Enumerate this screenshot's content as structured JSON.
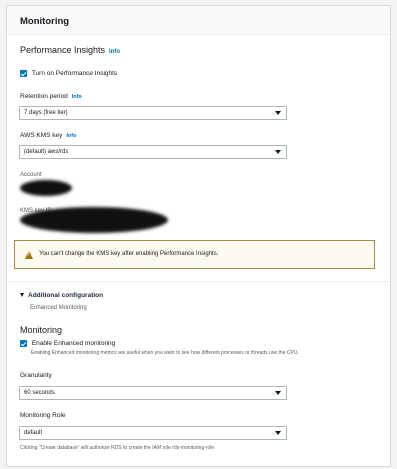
{
  "panel": {
    "title": "Monitoring"
  },
  "performance_insights": {
    "title": "Performance Insights",
    "info": "Info",
    "checkbox_label": "Turn on Performance Insights",
    "checked": true,
    "retention_label": "Retention period",
    "retention_info": "Info",
    "retention_value": "7 days (free tier)",
    "kms_label": "AWS KMS key",
    "kms_info": "Info",
    "kms_value": "(default) aws/rds",
    "account_label": "Account",
    "kms_key_id_label": "KMS key ID",
    "alert_text": "You can't change the KMS key after enabling Performance Insights."
  },
  "additional_configuration": {
    "title": "Additional configuration",
    "subtitle": "Enhanced Monitoring"
  },
  "monitoring": {
    "title": "Monitoring",
    "checkbox_label": "Enable Enhanced monitoring",
    "checked": true,
    "checkbox_description": "Enabling Enhanced monitoring metrics are useful when you want to see how different processes or threads use the CPU.",
    "granularity_label": "Granularity",
    "granularity_value": "60 seconds",
    "role_label": "Monitoring Role",
    "role_value": "default",
    "role_note": "Clicking \"Create database\" will authorize RDS to create the IAM role rds-monitoring-role"
  },
  "colors": {
    "accent": "#0073bb",
    "warning_border": "#9d8f3b",
    "warning_bg": "#fffaf0"
  }
}
